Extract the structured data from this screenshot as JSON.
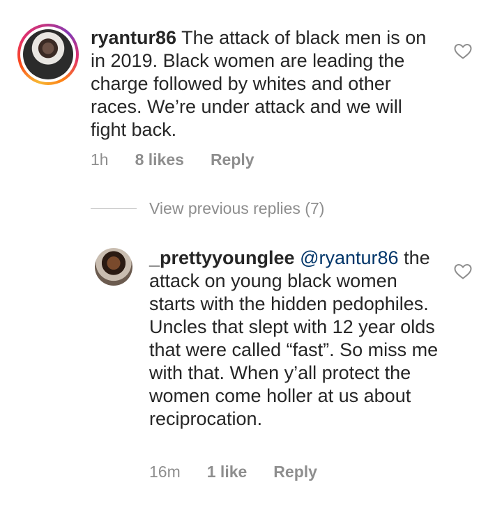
{
  "comments": [
    {
      "username": "ryantur86",
      "text": "The attack of black men is on in 2019. Black women are leading the charge followed by whites and other races. We’re under attack and we will fight back.",
      "time": "1h",
      "likes": "8 likes",
      "reply_label": "Reply"
    },
    {
      "username": "_prettyyounglee",
      "mention": "@ryantur86",
      "text": "the attack on young black women starts with the hidden pedophiles. Uncles that slept with 12 year olds that were called “fast”. So miss me with that. When y’all protect the women come holler at us about reciprocation.",
      "time": "16m",
      "likes": "1 like",
      "reply_label": "Reply"
    }
  ],
  "view_replies_label": "View previous replies (7)",
  "colors": {
    "text": "#262626",
    "meta": "#8e8e8e",
    "mention": "#003569"
  },
  "icons": [
    "heart-icon"
  ]
}
